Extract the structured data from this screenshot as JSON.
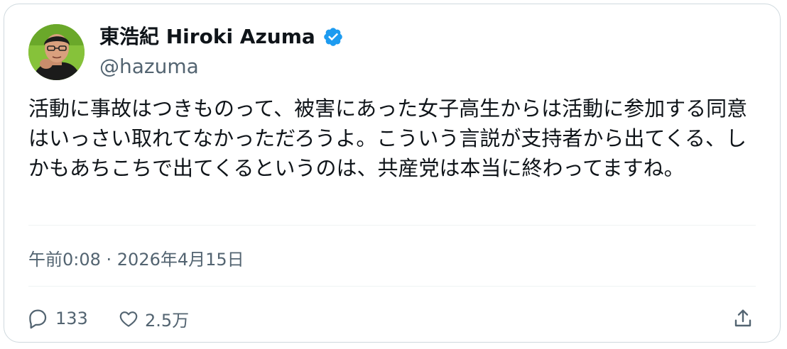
{
  "author": {
    "display_name": "東浩紀 Hiroki Azuma",
    "handle": "@hazuma",
    "verified_icon": "verified-badge-icon",
    "avatar_icon": "avatar"
  },
  "tweet": {
    "text": "活動に事故はつきものって、被害にあった女子高生からは活動に参加する同意はいっさい取れてなかっただろうよ。こういう言説が支持者から出てくる、しかもあちこちで出てくるというのは、共産党は本当に終わってますね。",
    "timestamp": "午前0:08 · 2026年4月15日"
  },
  "actions": {
    "reply_count": "133",
    "like_count": "2.5万",
    "reply_icon": "reply-icon",
    "like_icon": "heart-icon",
    "share_icon": "share-icon"
  },
  "colors": {
    "text": "#0f1419",
    "secondary": "#536471",
    "border": "#cfd9de",
    "verified": "#1d9bf0",
    "avatar_bg": "#7dbb33"
  }
}
